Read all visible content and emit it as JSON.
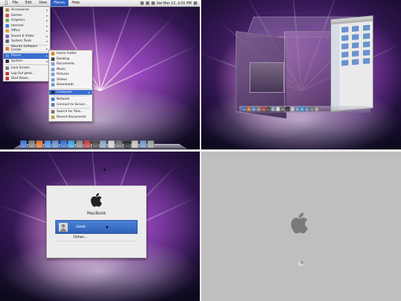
{
  "menubar": {
    "items": [
      "File",
      "Edit",
      "View",
      "Places",
      "Help"
    ],
    "active_index": 3,
    "clock": "Sat Mar 12, 2:01 PM"
  },
  "app_menu": {
    "items": [
      {
        "label": "Accessories",
        "icon": "accessories-icon",
        "color": "#b98b52"
      },
      {
        "label": "Games",
        "icon": "games-icon",
        "color": "#d44a4a"
      },
      {
        "label": "Graphics",
        "icon": "graphics-icon",
        "color": "#6fb04a"
      },
      {
        "label": "Internet",
        "icon": "internet-icon",
        "color": "#3d7dd6"
      },
      {
        "label": "Office",
        "icon": "office-icon",
        "color": "#e5a03c"
      },
      {
        "label": "Sound & Video",
        "icon": "sound-video-icon",
        "color": "#8a5cc0"
      },
      {
        "label": "System Tools",
        "icon": "system-tools-icon",
        "color": "#5f6b7a"
      },
      {
        "label": "Ubuntu Software Center",
        "icon": "software-center-icon",
        "color": "#e8722c"
      },
      {
        "label": "Places",
        "icon": "places-icon",
        "color": "#6f91c9"
      },
      {
        "label": "System",
        "icon": "system-icon",
        "color": "#333333"
      },
      {
        "label": "Lock Screen",
        "icon": "lock-icon",
        "color": "#7c7c7c"
      },
      {
        "label": "Log Out geek...",
        "icon": "logout-icon",
        "color": "#c23b3b"
      },
      {
        "label": "Shut Down...",
        "icon": "shutdown-icon",
        "color": "#c23b3b"
      }
    ]
  },
  "places_menu": {
    "items": [
      {
        "label": "Home Folder",
        "icon": "home-icon",
        "color": "#d9882c"
      },
      {
        "label": "Desktop",
        "icon": "desktop-icon",
        "color": "#4a4a4a"
      },
      {
        "label": "Documents",
        "icon": "folder-icon",
        "color": "#7b9fd6"
      },
      {
        "label": "Music",
        "icon": "folder-icon",
        "color": "#7b9fd6"
      },
      {
        "label": "Pictures",
        "icon": "folder-icon",
        "color": "#7b9fd6"
      },
      {
        "label": "Videos",
        "icon": "folder-icon",
        "color": "#7b9fd6"
      },
      {
        "label": "Downloads",
        "icon": "folder-icon",
        "color": "#7b9fd6"
      },
      {
        "label": "Computer",
        "icon": "computer-icon",
        "color": "#333333"
      },
      {
        "label": "Network",
        "icon": "network-icon",
        "color": "#4a7fd0"
      },
      {
        "label": "Connect to Server...",
        "icon": "server-icon",
        "color": "#5a7fb0"
      },
      {
        "label": "Search for Files...",
        "icon": "search-icon",
        "color": "#777777"
      },
      {
        "label": "Recent Documents",
        "icon": "recent-icon",
        "color": "#c99a4a"
      }
    ]
  },
  "dock_colors": [
    "#3b6fd0",
    "#7a7a7a",
    "#e0702a",
    "#4f8fe0",
    "#5a8bd6",
    "#2b6dd6",
    "#3aa0e0",
    "#888888",
    "#c23b3b",
    "#444444",
    "#8aa0c0",
    "#d0d0d0",
    "#6a6a6a",
    "#222222",
    "#bfbfbf",
    "#6f91c9",
    "#9a9a9a"
  ],
  "cube_dock_colors": [
    "#3b6fd0",
    "#e0702a",
    "#4f8fe0",
    "#888888",
    "#c23b3b",
    "#444444",
    "#8aa0c0",
    "#d0d0d0",
    "#6a6a6a",
    "#222222",
    "#bfbfbf",
    "#6f91c9",
    "#3aa0e0",
    "#5a8bd6",
    "#7a7a7a",
    "#9a9a9a"
  ],
  "login": {
    "hostname": "MacBook",
    "users": [
      {
        "name": "Geek",
        "selected": true
      },
      {
        "name": "Other...",
        "selected": false
      }
    ]
  }
}
